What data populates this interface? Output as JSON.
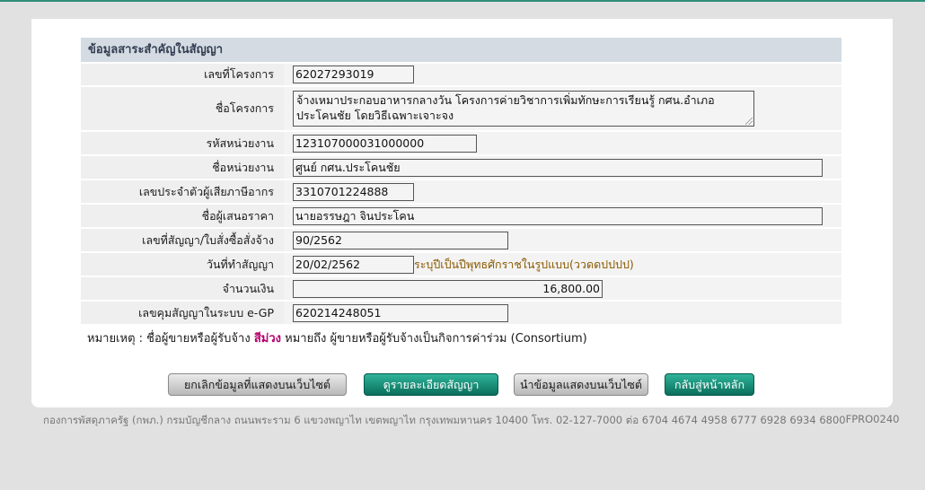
{
  "section": {
    "title": "ข้อมูลสาระสำคัญในสัญญา"
  },
  "fields": {
    "project_no": {
      "label": "เลขที่โครงการ",
      "value": "62027293019"
    },
    "project_name": {
      "label": "ชื่อโครงการ",
      "value_line1": "จ้างเหมาประกอบอาหารกลางวัน โครงการค่ายวิชาการเพิ่มทักษะการเรียนรู้ กศน.อำเภอ",
      "value_line2": "ประโคนชัย โดยวิธีเฉพาะเจาะจง"
    },
    "agency_code": {
      "label": "รหัสหน่วยงาน",
      "value": "123107000031000000"
    },
    "agency_name": {
      "label": "ชื่อหน่วยงาน",
      "value": "ศูนย์ กศน.ประโคนชัย"
    },
    "tax_id": {
      "label": "เลขประจำตัวผู้เสียภาษีอากร",
      "value": "3310701224888"
    },
    "bidder_name": {
      "label": "ชื่อผู้เสนอราคา",
      "value": "นายอรรษฎา จินประโคน"
    },
    "contract_no": {
      "label": "เลขที่สัญญา/ใบสั่งซื้อสั่งจ้าง",
      "value": "90/2562"
    },
    "contract_date": {
      "label": "วันที่ทำสัญญา",
      "value": "20/02/2562",
      "hint": "ระบุปีเป็นปีพุทธศักราชในรูปแบบ(ววดดปปปป)"
    },
    "amount": {
      "label": "จำนวนเงิน",
      "value": "16,800.00"
    },
    "egp_no": {
      "label": "เลขคุมสัญญาในระบบ e-GP",
      "value": "620214248051"
    }
  },
  "note": {
    "prefix": "หมายเหตุ : ชื่อผู้ขายหรือผู้รับจ้าง",
    "highlight": "สีม่วง",
    "suffix": "หมายถึง ผู้ขายหรือผู้รับจ้างเป็นกิจการค่าร่วม (Consortium)"
  },
  "buttons": {
    "cancel_web": "ยกเลิกข้อมูลที่แสดงบนเว็บไซต์",
    "view_contract": "ดูรายละเอียดสัญญา",
    "publish_web": "นำข้อมูลแสดงบนเว็บไซต์",
    "back_home": "กลับสู่หน้าหลัก"
  },
  "footer": {
    "address": "กองการพัสดุภาครัฐ (กพภ.) กรมบัญชีกลาง ถนนพระราม 6 แขวงพญาไท เขตพญาไท กรุงเทพมหานคร 10400 โทร. 02-127-7000 ต่อ 6704 4674 4958 6777 6928 6934 6800",
    "code": "FPRO0240"
  }
}
